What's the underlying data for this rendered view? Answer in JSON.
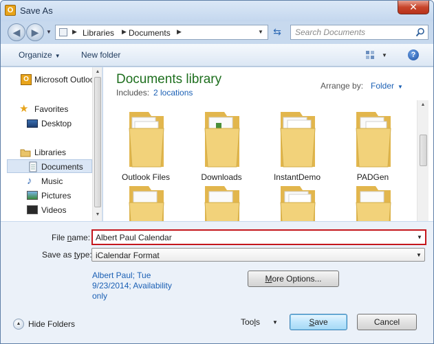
{
  "window": {
    "title": "Save As",
    "app_icon": "outlook-icon",
    "close_glyph": "✕"
  },
  "address": {
    "back_glyph": "◀",
    "forward_glyph": "▶",
    "crumbs": [
      "Libraries",
      "Documents"
    ],
    "refresh_glyph": "⇆"
  },
  "search": {
    "placeholder": "Search Documents"
  },
  "toolbar": {
    "organize_label": "Organize",
    "new_folder_label": "New folder",
    "help_glyph": "?"
  },
  "navigation": {
    "items": [
      {
        "label": "Microsoft Outlook",
        "icon": "outlook-icon"
      },
      {
        "label": "Favorites",
        "icon": "star-icon"
      },
      {
        "label": "Desktop",
        "icon": "desktop-icon"
      },
      {
        "label": "Libraries",
        "icon": "libraries-icon"
      },
      {
        "label": "Documents",
        "icon": "documents-icon",
        "selected": true
      },
      {
        "label": "Music",
        "icon": "music-icon"
      },
      {
        "label": "Pictures",
        "icon": "pictures-icon"
      },
      {
        "label": "Videos",
        "icon": "videos-icon"
      }
    ]
  },
  "library": {
    "title": "Documents library",
    "includes_label": "Includes:",
    "locations_link": "2 locations",
    "arrange_label": "Arrange by:",
    "arrange_value": "Folder"
  },
  "folders": [
    {
      "name": "Outlook Files"
    },
    {
      "name": "Downloads"
    },
    {
      "name": "InstantDemo"
    },
    {
      "name": "PADGen"
    },
    {
      "name": ""
    },
    {
      "name": ""
    },
    {
      "name": ""
    },
    {
      "name": ""
    }
  ],
  "form": {
    "file_name_label_pre": "File ",
    "file_name_label_key": "n",
    "file_name_label_post": "ame:",
    "file_name_value": "Albert Paul Calendar",
    "save_type_label_pre": "Save as ",
    "save_type_label_key": "t",
    "save_type_label_post": "ype:",
    "save_type_value": "iCalendar Format",
    "meta_text": "Albert Paul; Tue 9/23/2014; Availability only",
    "more_options_pre": "",
    "more_options_key": "M",
    "more_options_post": "ore Options...",
    "hide_folders_label": "Hide Folders",
    "tools_pre": "Too",
    "tools_key": "l",
    "tools_post": "s",
    "save_pre": "",
    "save_key": "S",
    "save_post": "ave",
    "cancel_label": "Cancel"
  },
  "colors": {
    "accent_green": "#1e6f1e",
    "link_blue": "#1a5fb4",
    "highlight_red": "#c4161c",
    "folder_yellow": "#f2d27a"
  }
}
